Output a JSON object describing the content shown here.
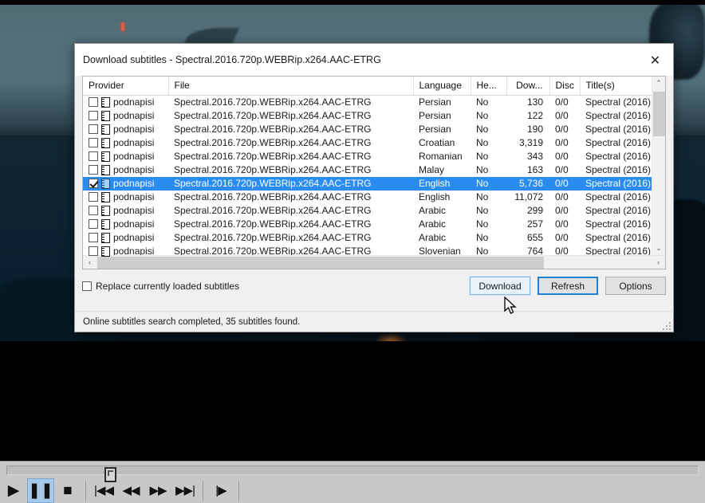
{
  "dialog": {
    "title": "Download subtitles - Spectral.2016.720p.WEBRip.x264.AAC-ETRG",
    "close_label": "✕",
    "columns": [
      {
        "key": "provider",
        "label": "Provider"
      },
      {
        "key": "file",
        "label": "File"
      },
      {
        "key": "language",
        "label": "Language"
      },
      {
        "key": "hearing",
        "label": "He..."
      },
      {
        "key": "downloads",
        "label": "Dow..."
      },
      {
        "key": "disc",
        "label": "Disc"
      },
      {
        "key": "titles",
        "label": "Title(s)"
      }
    ],
    "rows": [
      {
        "checked": false,
        "selected": false,
        "provider": "podnapisi",
        "file": "Spectral.2016.720p.WEBRip.x264.AAC-ETRG",
        "language": "Persian",
        "hearing": "No",
        "downloads": "130",
        "disc": "0/0",
        "titles": "Spectral (2016)"
      },
      {
        "checked": false,
        "selected": false,
        "provider": "podnapisi",
        "file": "Spectral.2016.720p.WEBRip.x264.AAC-ETRG",
        "language": "Persian",
        "hearing": "No",
        "downloads": "122",
        "disc": "0/0",
        "titles": "Spectral (2016)"
      },
      {
        "checked": false,
        "selected": false,
        "provider": "podnapisi",
        "file": "Spectral.2016.720p.WEBRip.x264.AAC-ETRG",
        "language": "Persian",
        "hearing": "No",
        "downloads": "190",
        "disc": "0/0",
        "titles": "Spectral (2016)"
      },
      {
        "checked": false,
        "selected": false,
        "provider": "podnapisi",
        "file": "Spectral.2016.720p.WEBRip.x264.AAC-ETRG",
        "language": "Croatian",
        "hearing": "No",
        "downloads": "3,319",
        "disc": "0/0",
        "titles": "Spectral (2016)"
      },
      {
        "checked": false,
        "selected": false,
        "provider": "podnapisi",
        "file": "Spectral.2016.720p.WEBRip.x264.AAC-ETRG",
        "language": "Romanian",
        "hearing": "No",
        "downloads": "343",
        "disc": "0/0",
        "titles": "Spectral (2016)"
      },
      {
        "checked": false,
        "selected": false,
        "provider": "podnapisi",
        "file": "Spectral.2016.720p.WEBRip.x264.AAC-ETRG",
        "language": "Malay",
        "hearing": "No",
        "downloads": "163",
        "disc": "0/0",
        "titles": "Spectral (2016)"
      },
      {
        "checked": true,
        "selected": true,
        "provider": "podnapisi",
        "file": "Spectral.2016.720p.WEBRip.x264.AAC-ETRG",
        "language": "English",
        "hearing": "No",
        "downloads": "5,736",
        "disc": "0/0",
        "titles": "Spectral (2016)"
      },
      {
        "checked": false,
        "selected": false,
        "provider": "podnapisi",
        "file": "Spectral.2016.720p.WEBRip.x264.AAC-ETRG",
        "language": "English",
        "hearing": "No",
        "downloads": "11,072",
        "disc": "0/0",
        "titles": "Spectral (2016)"
      },
      {
        "checked": false,
        "selected": false,
        "provider": "podnapisi",
        "file": "Spectral.2016.720p.WEBRip.x264.AAC-ETRG",
        "language": "Arabic",
        "hearing": "No",
        "downloads": "299",
        "disc": "0/0",
        "titles": "Spectral (2016)"
      },
      {
        "checked": false,
        "selected": false,
        "provider": "podnapisi",
        "file": "Spectral.2016.720p.WEBRip.x264.AAC-ETRG",
        "language": "Arabic",
        "hearing": "No",
        "downloads": "257",
        "disc": "0/0",
        "titles": "Spectral (2016)"
      },
      {
        "checked": false,
        "selected": false,
        "provider": "podnapisi",
        "file": "Spectral.2016.720p.WEBRip.x264.AAC-ETRG",
        "language": "Arabic",
        "hearing": "No",
        "downloads": "655",
        "disc": "0/0",
        "titles": "Spectral (2016)"
      },
      {
        "checked": false,
        "selected": false,
        "provider": "podnapisi",
        "file": "Spectral.2016.720p.WEBRip.x264.AAC-ETRG",
        "language": "Slovenian",
        "hearing": "No",
        "downloads": "764",
        "disc": "0/0",
        "titles": "Spectral (2016)"
      }
    ],
    "replace_checkbox": {
      "label": "Replace currently loaded subtitles",
      "checked": false
    },
    "buttons": {
      "download": "Download",
      "refresh": "Refresh",
      "options": "Options"
    },
    "status": "Online subtitles search completed, 35 subtitles found.",
    "scroll": {
      "up_arrow": "⌃",
      "down_arrow": "⌄",
      "left_arrow": "‹",
      "right_arrow": "›"
    },
    "accent_color": "#2a8cf0",
    "default_button_border": "#1f7fd0"
  },
  "player": {
    "buttons": [
      {
        "name": "play",
        "glyph": "▶"
      },
      {
        "name": "pause",
        "glyph": "❚❚"
      },
      {
        "name": "stop",
        "glyph": "■"
      },
      {
        "name": "skip-back",
        "glyph": "|◀◀"
      },
      {
        "name": "rewind",
        "glyph": "◀◀"
      },
      {
        "name": "fast-forward",
        "glyph": "▶▶"
      },
      {
        "name": "skip-forward",
        "glyph": "▶▶|"
      },
      {
        "name": "frame-step",
        "glyph": "|▶"
      }
    ],
    "active_button": "pause"
  }
}
